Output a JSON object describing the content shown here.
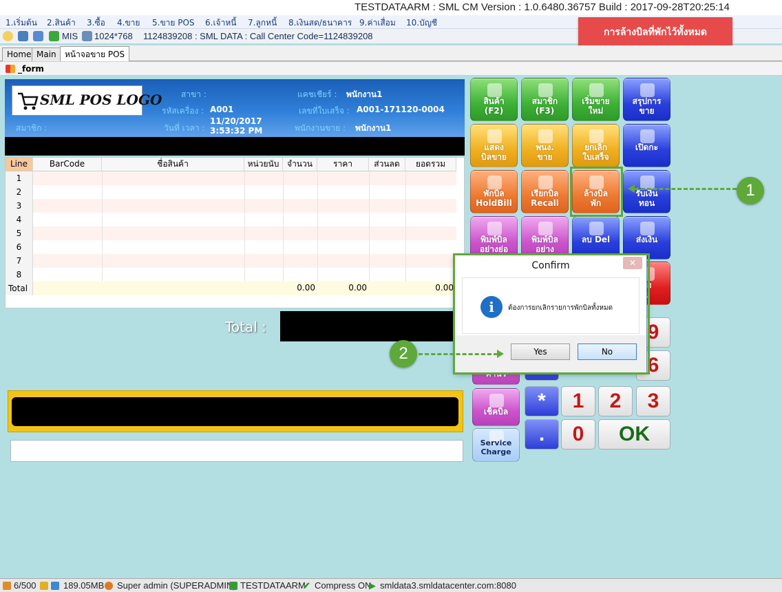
{
  "window_title": "TESTDATAARM : SML CM Version : 1.0.6480.36757  Build : 2017-09-28T20:25:14",
  "menu": [
    "1.เริ่มต้น",
    "2.สินค้า",
    "3.ซื้อ",
    "4.ขาย",
    "5.ขาย POS",
    "6.เจ้าหนี้",
    "7.ลูกหนี้",
    "8.เงินสด/ธนาคาร",
    "9.ค่าเสื่อม",
    "10.บัญชี"
  ],
  "toolbar": {
    "mis": "MIS",
    "resolution": "1024*768",
    "info": "1124839208 : SML DATA : Call Center Code=1124839208"
  },
  "banner": "การล้างบิลที่พักไว้ทั้งหมด",
  "tabs": [
    "Home",
    "Main",
    "หน้าจอขาย POS"
  ],
  "form_title": "_form",
  "header": {
    "logo": "SML POS LOGO",
    "branch_label": "สาขา :",
    "branch_value": "",
    "machine_label": "รหัสเครื่อง :",
    "machine_value": "A001",
    "datetime_label": "วันที่ เวลา :",
    "date_value": "11/20/2017",
    "time_value": "3:53:32 PM",
    "member_label": "สมาชิก :",
    "cashier_label": "แคชเชียร์ :",
    "cashier_value": "พนักงาน1",
    "receipt_label": "เลขที่ใบเสร็จ :",
    "receipt_value": "A001-171120-0004",
    "sales_label": "พนักงานขาย :",
    "sales_value": "พนักงาน1"
  },
  "grid": {
    "columns": [
      "Line",
      "BarCode",
      "ชื่อสินค้า",
      "หน่วยนับ",
      "จำนวน",
      "ราคา",
      "ส่วนลด",
      "ยอดรวม"
    ],
    "rows": [
      "1",
      "2",
      "3",
      "4",
      "5",
      "6",
      "7",
      "8"
    ],
    "total_label": "Total",
    "totals": {
      "qty": "0.00",
      "price": "0.00",
      "sum": "0.00"
    }
  },
  "total_label": "Total :",
  "buttons": [
    {
      "label": "สินค้า\n(F2)",
      "color": "#3fb236"
    },
    {
      "label": "สมาชิก\n(F3)",
      "color": "#3fb236"
    },
    {
      "label": "เริ่มขาย\nใหม่",
      "color": "#3fb236"
    },
    {
      "label": "สรุปการ\nขาย",
      "color": "#2a40dd"
    },
    {
      "label": "แสดง\nบิลขาย",
      "color": "#f0b020"
    },
    {
      "label": "พนง.\nขาย",
      "color": "#f0b020"
    },
    {
      "label": "ยกเลิก\nใบเสร็จ",
      "color": "#f0b020"
    },
    {
      "label": "เปิดกะ",
      "color": "#2a40dd"
    },
    {
      "label": "พักบิล\nHoldBill",
      "color": "#ee7a30"
    },
    {
      "label": "เรียกบิล\nRecall",
      "color": "#ee7a30"
    },
    {
      "label": "ล้างบิล\nพัก",
      "color": "#ee7a30"
    },
    {
      "label": "รับเงิน\nทอน",
      "color": "#2a40dd"
    },
    {
      "label": "พิมพ์บิล\nอย่างย่อ\nใหม่",
      "color": "#cc55cc"
    },
    {
      "label": "พิมพ์บิล\nอย่าง\nเต็ม",
      "color": "#cc55cc"
    },
    {
      "label": "ลบ  Del",
      "color": "#2a40dd"
    },
    {
      "label": "ส่งเงิน",
      "color": "#2a40dd"
    },
    {
      "label": "ถือ\nย",
      "color": "#e02020"
    }
  ],
  "side_buttons": {
    "check_bill": "เช็คบิล",
    "service_charge": "Service\nCharge",
    "partial": "คำนว"
  },
  "keypad": {
    "k9": "9",
    "k6": "6",
    "k1": "1",
    "k2": "2",
    "k3": "3",
    "k0": "0",
    "star": "*",
    "dot": ".",
    "ok": "OK"
  },
  "callouts": {
    "one": "1",
    "two": "2"
  },
  "dialog": {
    "title": "Confirm",
    "message": "ต้องการยกเลิกรายการพักบิลทั้งหมด",
    "yes": "Yes",
    "no": "No",
    "close": "✕",
    "info_glyph": "i"
  },
  "status": {
    "count": "6/500",
    "memory": "189.05MB",
    "user": "Super admin (SUPERADMIN)",
    "db": "TESTDATAARM",
    "compress": "Compress ON",
    "server": "smldata3.smldatacenter.com:8080"
  }
}
